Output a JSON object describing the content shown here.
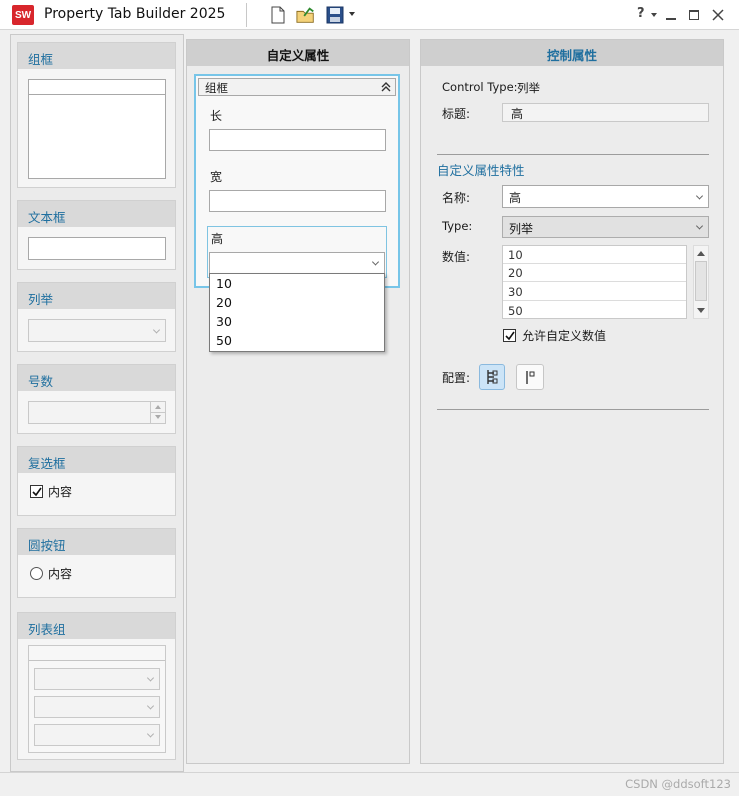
{
  "window": {
    "logo_text": "SW",
    "title": "Property Tab Builder 2025",
    "help_label": "?"
  },
  "toolbox": {
    "group_box": {
      "title": "组框"
    },
    "text_box": {
      "title": "文本框"
    },
    "list": {
      "title": "列举"
    },
    "number": {
      "title": "号数"
    },
    "checkbox": {
      "title": "复选框",
      "label": "内容",
      "checked": true
    },
    "radio": {
      "title": "圆按钮",
      "label": "内容"
    },
    "list_group": {
      "title": "列表组"
    }
  },
  "custom_props": {
    "header": "自定义属性",
    "group": {
      "title": "组框",
      "fields": [
        {
          "label": "长",
          "value": ""
        },
        {
          "label": "宽",
          "value": ""
        }
      ],
      "combo": {
        "label": "高",
        "value": "",
        "options": [
          "10",
          "20",
          "30",
          "50"
        ]
      }
    }
  },
  "control_props": {
    "header": "控制属性",
    "control_type_label": "Control Type:",
    "control_type_value": "列举",
    "caption_label": "标题:",
    "caption_value": "高",
    "section_title": "自定义属性特性",
    "name_label": "名称:",
    "name_value": "高",
    "type_label": "Type:",
    "type_value": "列举",
    "values_label": "数值:",
    "values": [
      "10",
      "20",
      "30",
      "50"
    ],
    "allow_custom_label": "允许自定义数值",
    "allow_custom_checked": true,
    "config_label": "配置:"
  },
  "statusbar": {
    "watermark": "CSDN @ddsoft123"
  }
}
